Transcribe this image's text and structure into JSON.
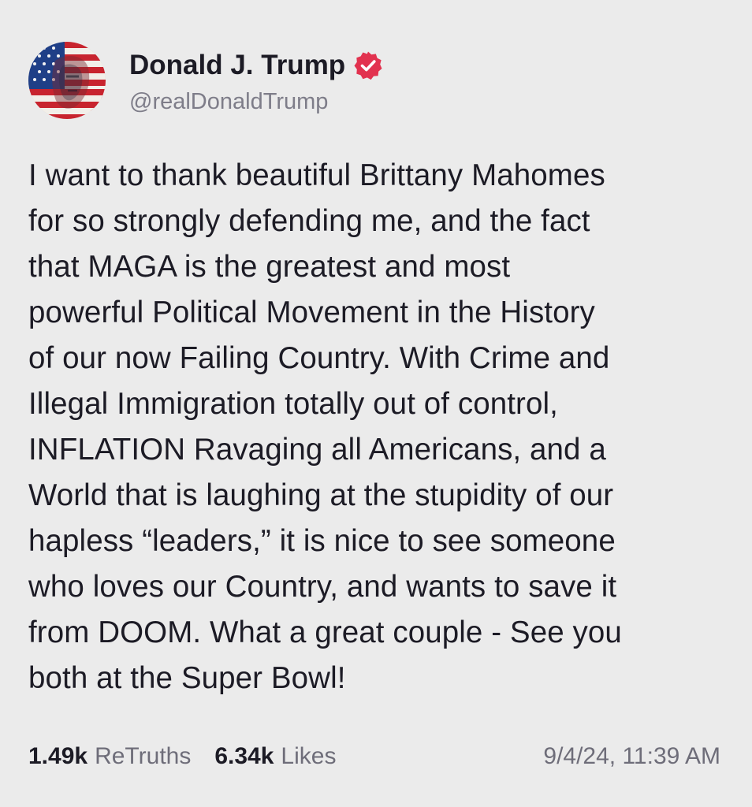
{
  "post": {
    "author": {
      "display_name": "Donald J. Trump",
      "handle": "@realDonaldTrump",
      "verified_icon": "verified-badge-icon",
      "verified_color": "#e2324f",
      "avatar_icon": "flag-portrait-avatar"
    },
    "text": "I want to thank beautiful Brittany Mahomes\nfor so strongly defending me, and the fact\nthat MAGA is the greatest and most\npowerful Political Movement in the History\nof our now Failing Country. With Crime and\nIllegal Immigration totally out of control,\nINFLATION Ravaging all Americans, and a\nWorld that is laughing at the stupidity of our\nhapless “leaders,” it is nice to see someone\nwho loves our Country, and wants to save it\nfrom DOOM. What a great couple - See you\nboth at the Super Bowl!",
    "stats": {
      "retruths_count": "1.49k",
      "retruths_label": "ReTruths",
      "likes_count": "6.34k",
      "likes_label": "Likes"
    },
    "timestamp": "9/4/24, 11:39 AM"
  },
  "colors": {
    "background": "#ebebeb",
    "text_primary": "#1c1b25",
    "text_secondary": "#7e7d89",
    "verified": "#e2324f"
  }
}
